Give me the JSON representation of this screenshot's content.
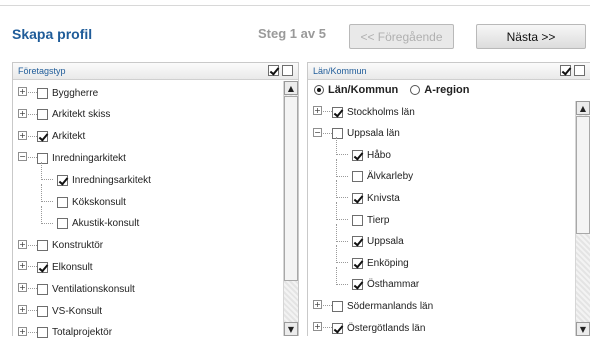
{
  "header": {
    "title": "Skapa profil",
    "step": "Steg 1 av 5",
    "prev_label": "<< Föregående",
    "next_label": "Nästa >>"
  },
  "left_panel": {
    "title": "Företagstyp",
    "items": [
      {
        "label": "Byggherre",
        "checked": false,
        "level": 0,
        "expander": "+"
      },
      {
        "label": "Arkitekt skiss",
        "checked": false,
        "level": 0,
        "expander": "+"
      },
      {
        "label": "Arkitekt",
        "checked": true,
        "level": 0,
        "expander": "+"
      },
      {
        "label": "Inredningarkitekt",
        "checked": false,
        "level": 0,
        "expander": "-"
      },
      {
        "label": "Inredningsarkitekt",
        "checked": true,
        "level": 1
      },
      {
        "label": "Kökskonsult",
        "checked": false,
        "level": 1
      },
      {
        "label": "Akustik-konsult",
        "checked": false,
        "level": 1
      },
      {
        "label": "Konstruktör",
        "checked": false,
        "level": 0,
        "expander": "+"
      },
      {
        "label": "Elkonsult",
        "checked": true,
        "level": 0,
        "expander": "+"
      },
      {
        "label": "Ventilationskonsult",
        "checked": false,
        "level": 0,
        "expander": "+"
      },
      {
        "label": "VS-Konsult",
        "checked": false,
        "level": 0,
        "expander": "+"
      },
      {
        "label": "Totalprojektör",
        "checked": false,
        "level": 0,
        "expander": "+"
      }
    ]
  },
  "right_panel": {
    "title": "Län/Kommun",
    "radio_options": [
      {
        "label": "Län/Kommun",
        "selected": true
      },
      {
        "label": "A-region",
        "selected": false
      }
    ],
    "items": [
      {
        "label": "Stockholms län",
        "checked": true,
        "level": 0,
        "expander": "+"
      },
      {
        "label": "Uppsala län",
        "checked": false,
        "level": 0,
        "expander": "-"
      },
      {
        "label": "Håbo",
        "checked": true,
        "level": 1
      },
      {
        "label": "Älvkarleby",
        "checked": false,
        "level": 1
      },
      {
        "label": "Knivsta",
        "checked": true,
        "level": 1
      },
      {
        "label": "Tierp",
        "checked": false,
        "level": 1
      },
      {
        "label": "Uppsala",
        "checked": true,
        "level": 1
      },
      {
        "label": "Enköping",
        "checked": true,
        "level": 1
      },
      {
        "label": "Östhammar",
        "checked": true,
        "level": 1
      },
      {
        "label": "Södermanlands län",
        "checked": false,
        "level": 0,
        "expander": "+"
      },
      {
        "label": "Östergötlands län",
        "checked": true,
        "level": 0,
        "expander": "+"
      }
    ]
  },
  "colors": {
    "title": "#1f5c99",
    "step": "#9a9a9a"
  }
}
